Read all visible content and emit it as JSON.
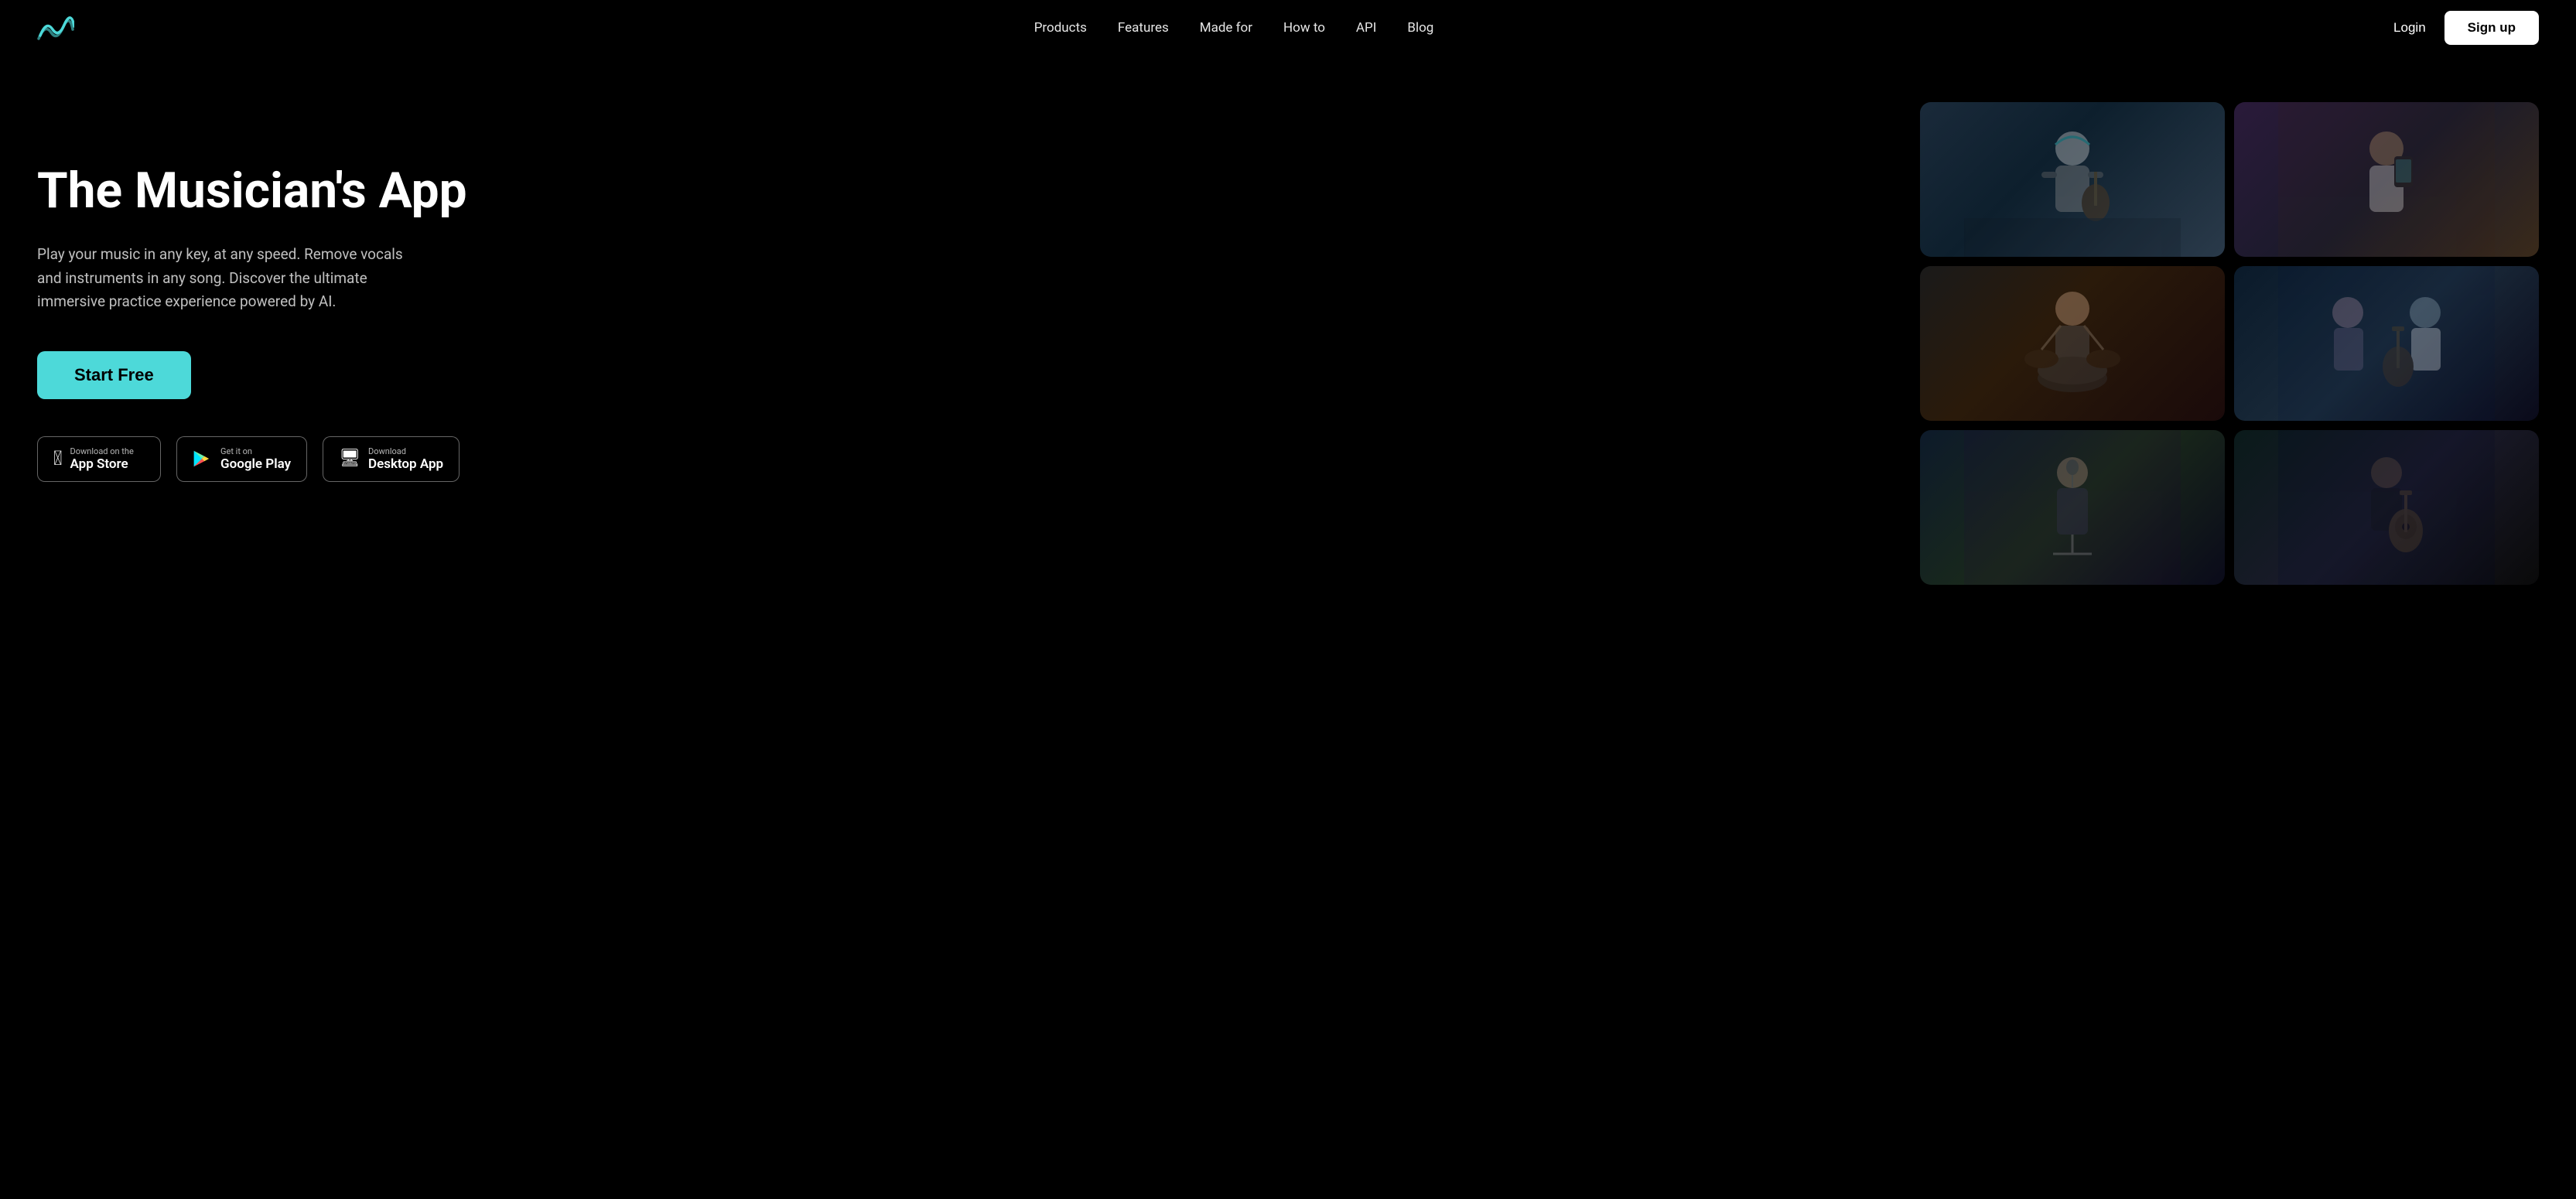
{
  "nav": {
    "logo_alt": "Moises",
    "links": [
      {
        "label": "Products",
        "id": "products"
      },
      {
        "label": "Features",
        "id": "features"
      },
      {
        "label": "Made for",
        "id": "made-for"
      },
      {
        "label": "How to",
        "id": "how-to"
      },
      {
        "label": "API",
        "id": "api"
      },
      {
        "label": "Blog",
        "id": "blog"
      }
    ],
    "login_label": "Login",
    "signup_label": "Sign up"
  },
  "hero": {
    "title": "The Musician's App",
    "subtitle": "Play your music in any key, at any speed. Remove vocals and instruments in any song. Discover the ultimate immersive practice experience powered by AI.",
    "cta_label": "Start Free",
    "store_buttons": [
      {
        "id": "app-store",
        "sub_text": "Download on the",
        "main_text": "App Store",
        "icon": "apple"
      },
      {
        "id": "google-play",
        "sub_text": "Get it on",
        "main_text": "Google Play",
        "icon": "play"
      },
      {
        "id": "desktop-app",
        "sub_text": "Download",
        "main_text": "Desktop App",
        "icon": "desktop"
      }
    ]
  },
  "colors": {
    "background": "#000000",
    "accent": "#4dd9d9",
    "text_primary": "#ffffff",
    "text_muted": "rgba(255,255,255,0.75)"
  }
}
